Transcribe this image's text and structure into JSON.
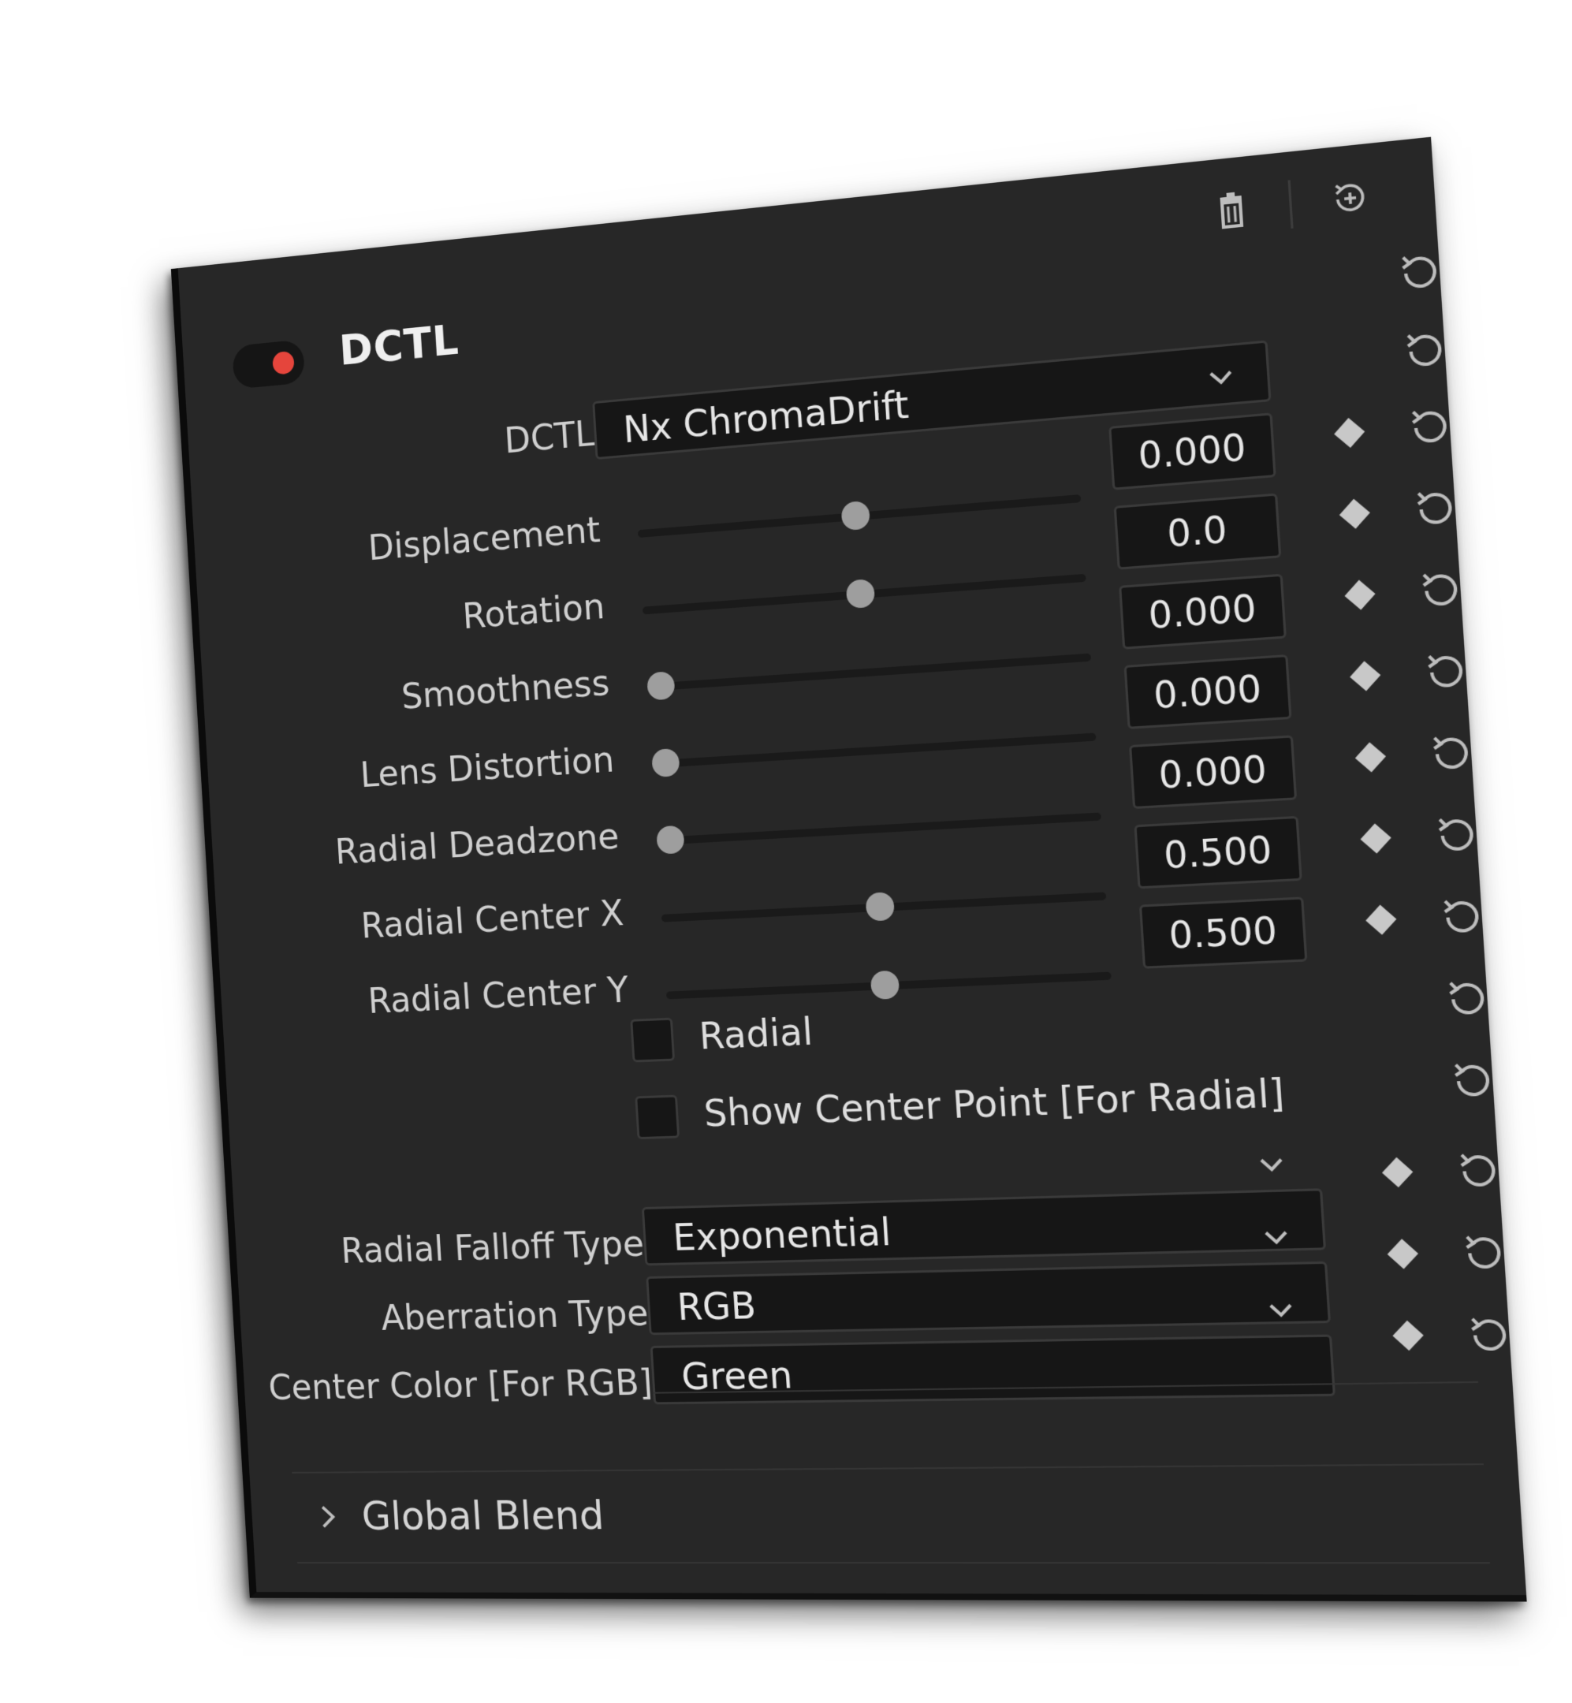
{
  "header": {
    "title": "DCTL",
    "enabled": true,
    "toggle_color": "#e5453c",
    "icons": [
      "trash-icon",
      "reset-all-icon"
    ]
  },
  "dctl_select": {
    "label": "DCTL",
    "value": "Nx ChromaDrift"
  },
  "sliders": [
    {
      "label": "Displacement",
      "value": "0.000",
      "position": 0.5
    },
    {
      "label": "Rotation",
      "value": "0.0",
      "position": 0.5
    },
    {
      "label": "Smoothness",
      "value": "0.000",
      "position": 0.0
    },
    {
      "label": "Lens Distortion",
      "value": "0.000",
      "position": 0.0
    },
    {
      "label": "Radial Deadzone",
      "value": "0.000",
      "position": 0.0
    },
    {
      "label": "Radial Center X",
      "value": "0.500",
      "position": 0.5
    },
    {
      "label": "Radial Center Y",
      "value": "0.500",
      "position": 0.5
    }
  ],
  "checkboxes": [
    {
      "label": "Radial",
      "checked": false
    },
    {
      "label": "Show Center Point [For Radial]",
      "checked": false
    }
  ],
  "dropdowns": [
    {
      "label": "Radial Falloff Type",
      "value": "Exponential"
    },
    {
      "label": "Aberration Type",
      "value": "RGB"
    },
    {
      "label": "Center Color [For RGB]",
      "value": "Green"
    }
  ],
  "section": {
    "label": "Global Blend",
    "expanded": false
  }
}
